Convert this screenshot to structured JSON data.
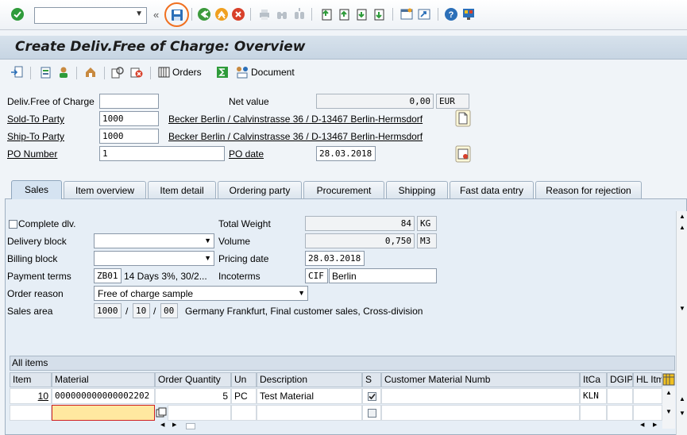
{
  "window": {
    "title": "Create Deliv.Free of Charge: Overview"
  },
  "toolbar": {
    "command_field_value": "",
    "icons": [
      "enter-icon",
      "save-icon",
      "back-icon",
      "exit-icon",
      "cancel-icon",
      "print-icon",
      "find-icon",
      "find-next-icon",
      "first-page-icon",
      "previous-page-icon",
      "next-page-icon",
      "last-page-icon",
      "new-session-icon",
      "shortcut-icon",
      "help-icon",
      "customize-layout-icon"
    ]
  },
  "app_toolbar": {
    "orders_label": "Orders",
    "document_label": "Document"
  },
  "header": {
    "delivfree_label": "Deliv.Free of Charge",
    "delivfree_value": "",
    "netvalue_label": "Net value",
    "netvalue_value": "0,00",
    "netvalue_currency": "EUR",
    "soldto_label": "Sold-To Party",
    "soldto_value": "1000",
    "soldto_name": "Becker Berlin / Calvinstrasse 36 / D-13467 Berlin-Hermsdorf",
    "shipto_label": "Ship-To Party",
    "shipto_value": "1000",
    "shipto_name": "Becker Berlin / Calvinstrasse 36 / D-13467 Berlin-Hermsdorf",
    "ponumber_label": "PO Number",
    "ponumber_value": "1",
    "podate_label": "PO date",
    "podate_value": "28.03.2018"
  },
  "tabs": [
    {
      "label": "Sales",
      "active": true
    },
    {
      "label": "Item overview"
    },
    {
      "label": "Item detail"
    },
    {
      "label": "Ordering party"
    },
    {
      "label": "Procurement"
    },
    {
      "label": "Shipping"
    },
    {
      "label": "Fast data entry"
    },
    {
      "label": "Reason for rejection"
    }
  ],
  "sales": {
    "complete_dlv_label": "Complete dlv.",
    "complete_dlv_checked": false,
    "delivery_block_label": "Delivery block",
    "delivery_block_value": "",
    "billing_block_label": "Billing block",
    "billing_block_value": "",
    "payment_terms_label": "Payment terms",
    "payment_terms_code": "ZB01",
    "payment_terms_text": "14 Days 3%, 30/2...",
    "order_reason_label": "Order reason",
    "order_reason_value": "Free of charge sample",
    "sales_area_label": "Sales area",
    "sales_area_org": "1000",
    "sales_area_channel": "10",
    "sales_area_division": "00",
    "sales_area_sep1": "/",
    "sales_area_sep2": "/",
    "sales_area_text": "Germany Frankfurt, Final customer sales, Cross-division",
    "total_weight_label": "Total Weight",
    "total_weight_value": "84",
    "total_weight_unit": "KG",
    "volume_label": "Volume",
    "volume_value": "0,750",
    "volume_unit": "M3",
    "pricing_date_label": "Pricing date",
    "pricing_date_value": "28.03.2018",
    "incoterms_label": "Incoterms",
    "incoterms_code": "CIF",
    "incoterms_place": "Berlin"
  },
  "items": {
    "title": "All items",
    "columns": [
      "Item",
      "Material",
      "Order Quantity",
      "Un",
      "Description",
      "S",
      "Customer Material Numb",
      "ItCa",
      "DGIP",
      "HL Itm"
    ],
    "rows": [
      {
        "item": "10",
        "material": "000000000000002202",
        "qty": "5",
        "unit": "PC",
        "description": "Test Material",
        "s_checked": true,
        "cust_material": "",
        "itca": "KLN",
        "dgip": "",
        "hl_itm": ""
      },
      {
        "item": "",
        "material": "",
        "qty": "",
        "unit": "",
        "description": "",
        "s_checked": false,
        "cust_material": "",
        "itca": "",
        "dgip": "",
        "hl_itm": ""
      }
    ]
  },
  "colors": {
    "save_highlight": "#f07020",
    "title_bar": "#c7d5e3",
    "input_highlight": "#ffe8a0"
  }
}
